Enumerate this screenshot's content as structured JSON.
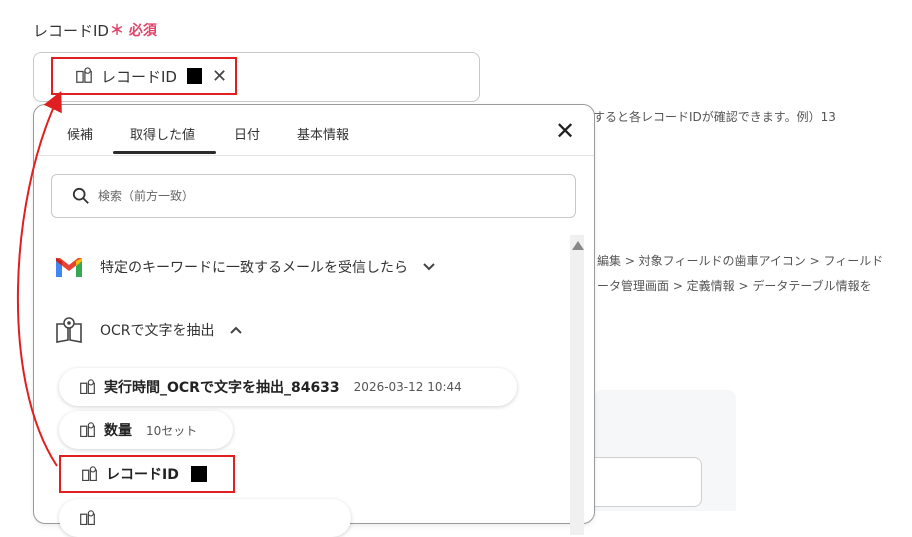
{
  "field": {
    "label": "レコードID",
    "required": "＊ 必須",
    "chip_label": "レコードID",
    "chip_close": "✕"
  },
  "background": {
    "hint": "すると各レコードIDが確認できます。例）13",
    "path1": "編集 > 対象フィールドの歯車アイコン > フィールド",
    "path2": "ータ管理画面 > 定義情報 > データテーブル情報を"
  },
  "popup": {
    "tabs": [
      "候補",
      "取得した値",
      "日付",
      "基本情報"
    ],
    "active_tab": "取得した値",
    "close": "✕",
    "search_placeholder": "検索（前方一致）",
    "sections": [
      {
        "icon": "gmail-icon",
        "label": "特定のキーワードに一致するメールを受信したら",
        "chevron": "⌄"
      },
      {
        "icon": "ocr-book-icon",
        "label": "OCRで文字を抽出",
        "chevron": "⌃"
      }
    ],
    "items": [
      {
        "label": "実行時間_OCRで文字を抽出_84633",
        "value": "2026-03-12 10:44"
      },
      {
        "label": "数量",
        "value": "10セット"
      },
      {
        "label": "レコードID",
        "value": ""
      }
    ]
  },
  "colors": {
    "required": "#e0446a",
    "highlight": "#e02020"
  }
}
